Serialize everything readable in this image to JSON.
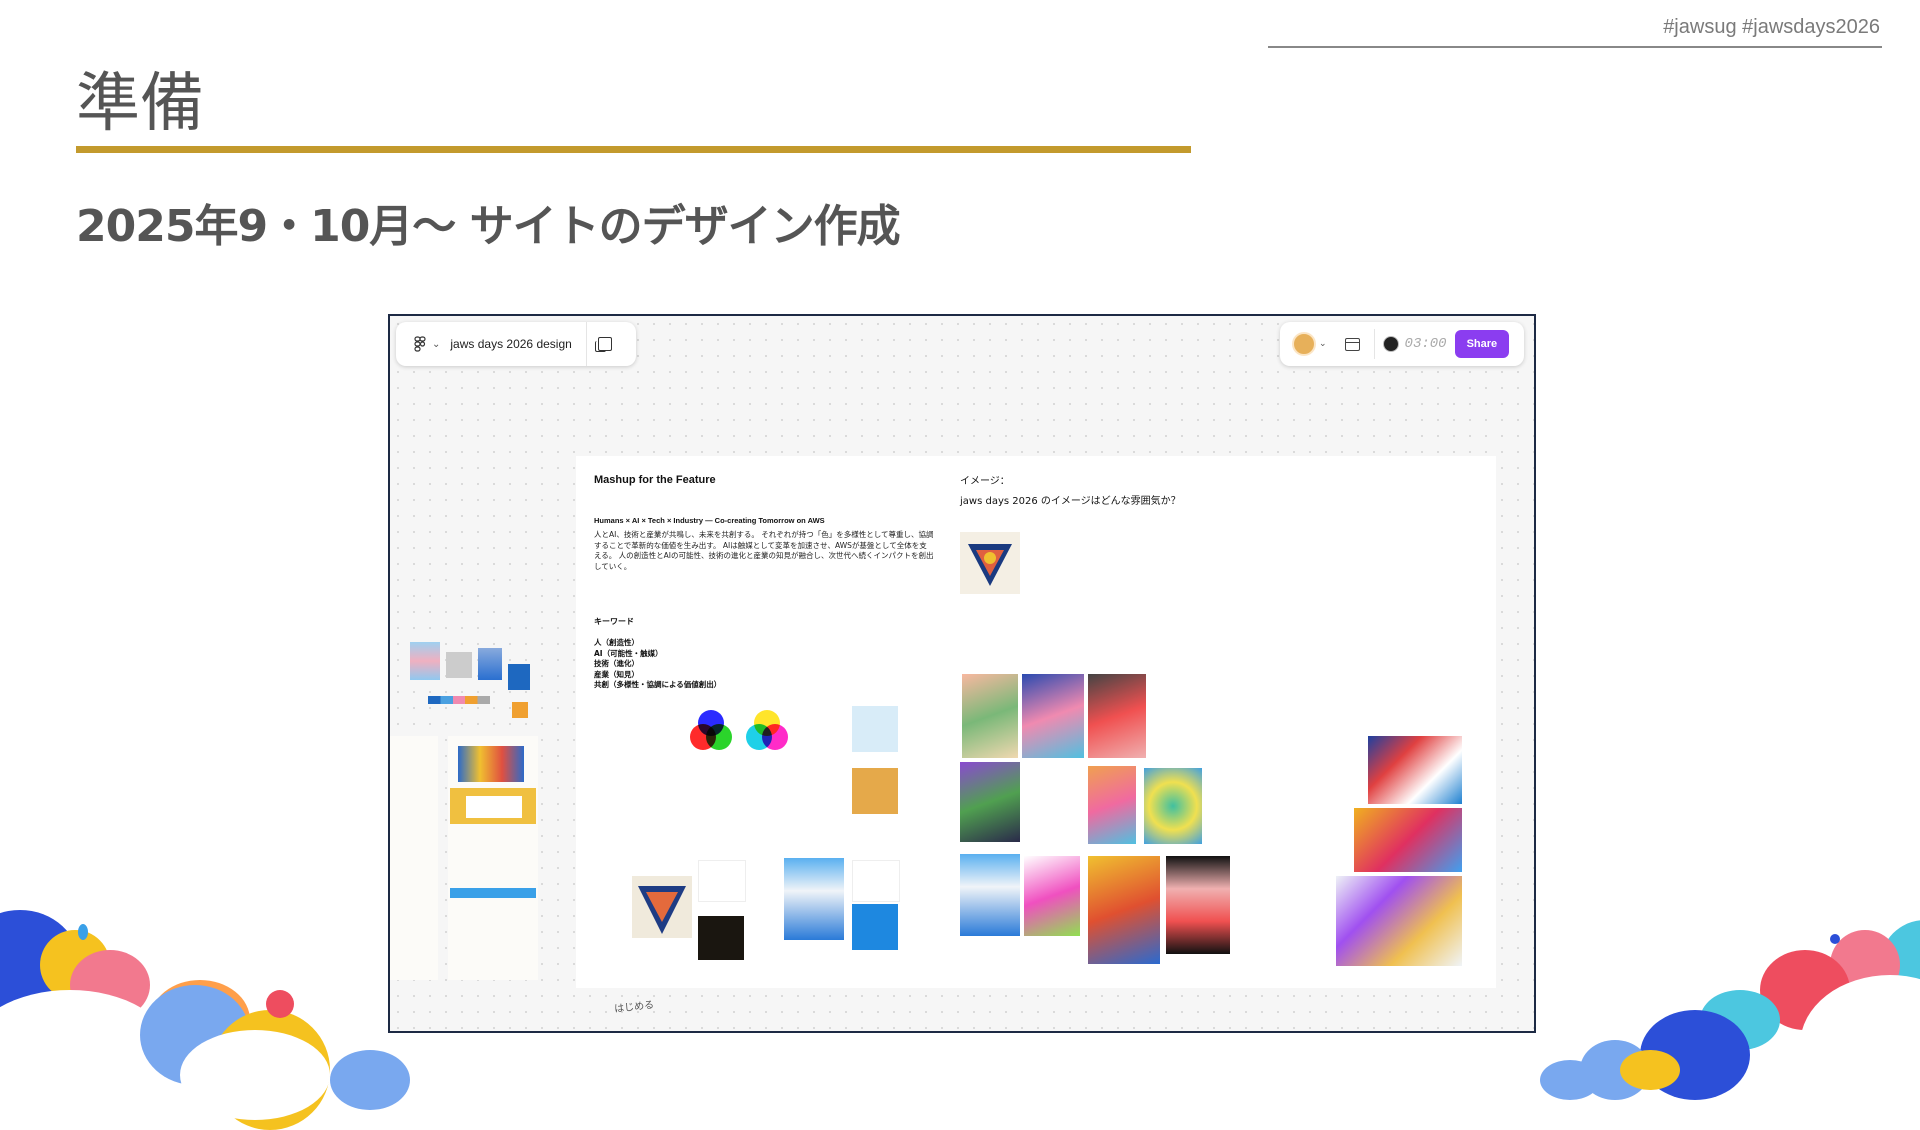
{
  "slide": {
    "hashtags": "#jawsug #jawsdays2026",
    "title": "準備",
    "subtitle": "2025年9・10月〜 サイトのデザイン作成"
  },
  "app": {
    "file_name": "jaws days 2026 design",
    "timer": "03:00",
    "share_label": "Share"
  },
  "board": {
    "heading": "Mashup for the Feature",
    "tagline": "Humans × AI × Tech × Industry — Co-creating Tomorrow on AWS",
    "description": "人とAI、技術と産業が共鳴し、未来を共創する。 それぞれが持つ「色」を多様性として尊重し、協調することで革新的な価値を生み出す。 AIは触媒として変革を加速させ、AWSが基盤として全体を支える。 人の創造性とAIの可能性、技術の進化と産業の知見が融合し、次世代へ続くインパクトを創出していく。",
    "keywords_title": "キーワード",
    "keywords": [
      "人（創造性）",
      "AI（可能性・触媒）",
      "技術（進化）",
      "産業（知見）",
      "共創（多様性・協調による価値創出）"
    ],
    "image_label": "イメージ：",
    "image_question": "jaws days 2026 のイメージはどんな雰囲気か？",
    "handwritten_note": "はじめる"
  },
  "colors": {
    "accent_gold": "#c39a2d",
    "share_purple": "#8b3df0",
    "frame_navy": "#1d2a44"
  }
}
